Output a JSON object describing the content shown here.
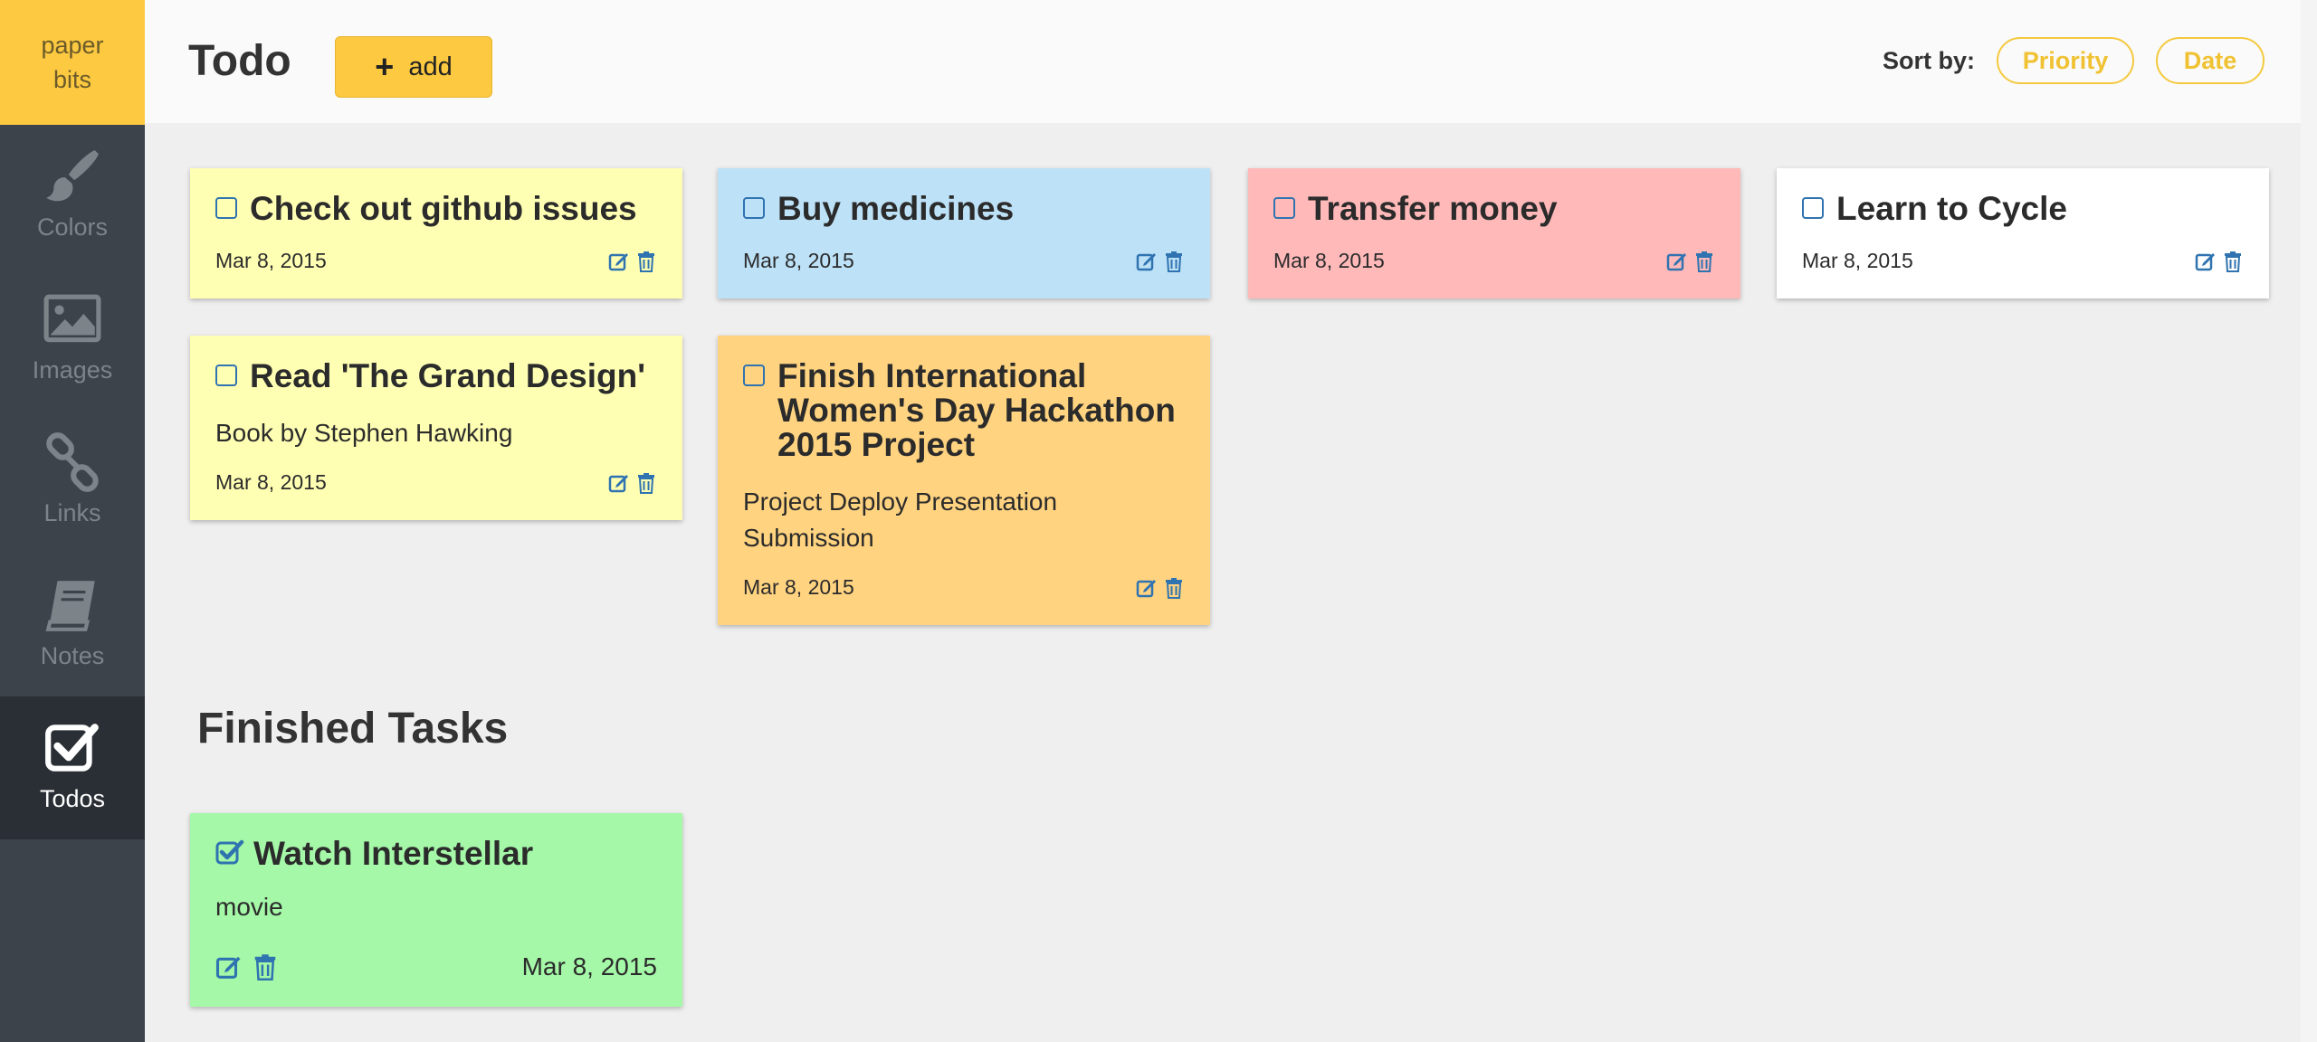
{
  "app": {
    "logo_line1": "paper",
    "logo_line2": "bits"
  },
  "sidebar": {
    "items": [
      {
        "label": "Colors",
        "icon": "paintbrush-icon"
      },
      {
        "label": "Images",
        "icon": "image-icon"
      },
      {
        "label": "Links",
        "icon": "link-icon"
      },
      {
        "label": "Notes",
        "icon": "book-icon"
      },
      {
        "label": "Todos",
        "icon": "checkbox-icon",
        "active": true
      }
    ]
  },
  "header": {
    "title": "Todo",
    "add_label": "add",
    "sort_label": "Sort by:",
    "sort_options": [
      "Priority",
      "Date"
    ]
  },
  "todos": [
    {
      "title": "Check out github issues",
      "date": "Mar 8, 2015",
      "color": "#ffffb4"
    },
    {
      "title": "Buy medicines",
      "date": "Mar 8, 2015",
      "color": "#bde1f7"
    },
    {
      "title": "Transfer money",
      "date": "Mar 8, 2015",
      "color": "#ffb9b9"
    },
    {
      "title": "Learn to Cycle",
      "date": "Mar 8, 2015",
      "color": "#ffffff"
    },
    {
      "title": "Read 'The Grand Design'",
      "description": "Book by Stephen Hawking",
      "date": "Mar 8, 2015",
      "color": "#ffffb4"
    },
    {
      "title": "Finish International Women's Day Hackathon 2015 Project",
      "description": "Project Deploy Presentation Submission",
      "date": "Mar 8, 2015",
      "color": "#ffd380"
    }
  ],
  "finished": {
    "heading": "Finished Tasks",
    "items": [
      {
        "title": "Watch Interstellar",
        "description": "movie",
        "date": "Mar 8, 2015",
        "color": "#a5f8a8",
        "done": true
      }
    ]
  },
  "colors": {
    "accent": "#fcc940",
    "sidebar": "#3c434b",
    "sidebar_active": "#2a2f35",
    "icon_blue": "#2f73b0"
  }
}
